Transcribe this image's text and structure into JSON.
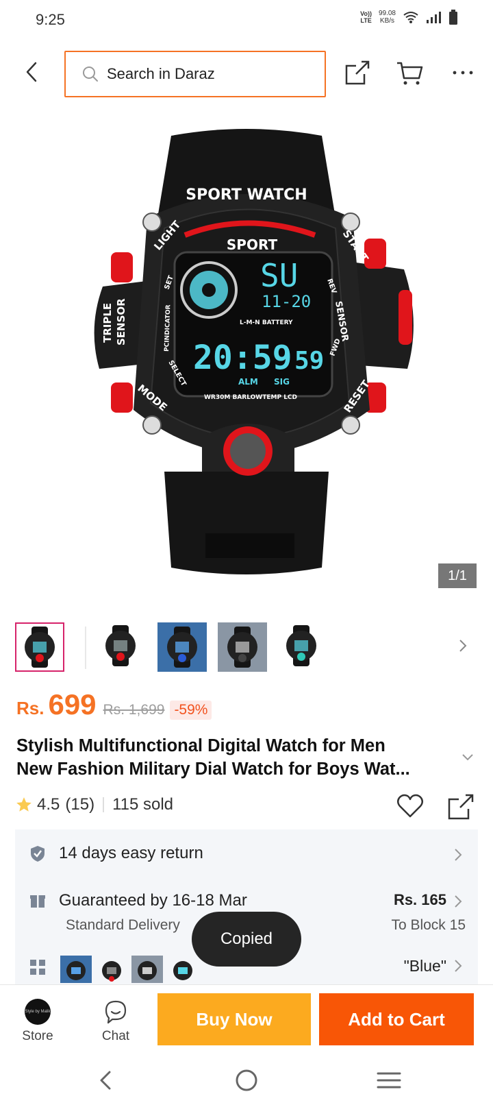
{
  "status_bar": {
    "time": "9:25",
    "volte_line1": "Vo))",
    "volte_line2": "LTE",
    "speed_value": "99.08",
    "speed_unit": "KB/s"
  },
  "header": {
    "search_placeholder": "Search in Daraz",
    "accent_color": "#f57224"
  },
  "gallery": {
    "counter": "1/1",
    "watch_texts": {
      "brand": "SPORT WATCH",
      "sport": "SPORT",
      "light": "LIGHT",
      "start": "START",
      "mode": "MODE",
      "reset": "RESET",
      "triple": "TRIPLE",
      "sensor_left": "SENSOR",
      "sensor_right": "SENSOR",
      "lcd_top": "SU",
      "lcd_date": "11-20",
      "lcd_time": "20:59",
      "lcd_sec": "59",
      "alm": "ALM",
      "sig": "SIG",
      "battery": "L-M-N BATTERY",
      "wr": "WR30M BARLOWTEMP LCD",
      "pcind": "PCINDICATOR",
      "select": "SELECT",
      "set": "SET",
      "rev": "REV",
      "fwd": "FWD"
    },
    "thumbnail_count": 5
  },
  "price": {
    "currency": "Rs.",
    "value": "699",
    "original": "Rs. 1,699",
    "discount": "-59%"
  },
  "product": {
    "title_line1": "Stylish Multifunctional Digital Watch for Men",
    "title_line2": "New Fashion Military Dial Watch for Boys Wat..."
  },
  "rating": {
    "score": "4.5",
    "count": "(15)",
    "sold": "115 sold",
    "star_color": "#faca51"
  },
  "services": {
    "return_label": "14 days easy return",
    "delivery_label": "Guaranteed by 16-18 Mar",
    "delivery_type": "Standard Delivery",
    "delivery_fee": "Rs. 165",
    "delivery_location": "To Block 15",
    "variant_selected": "\"Blue\""
  },
  "toast": {
    "message": "Copied"
  },
  "actions": {
    "store_label": "Store",
    "store_logo_text": "Style by Malik",
    "chat_label": "Chat",
    "buy_now": "Buy Now",
    "add_to_cart": "Add to Cart",
    "buy_color": "#fcaa1f",
    "cart_color": "#f85606"
  }
}
